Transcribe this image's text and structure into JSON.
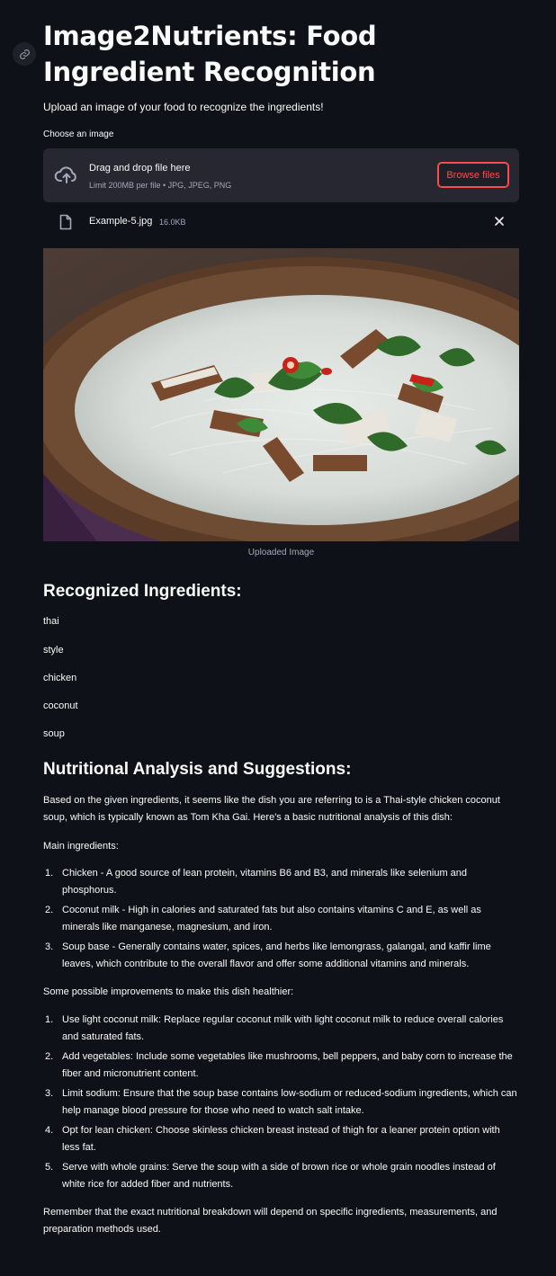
{
  "header": {
    "link_icon": "link-icon",
    "title": "Image2Nutrients: Food Ingredient Recognition",
    "subtitle": "Upload an image of your food to recognize the ingredients!"
  },
  "uploader": {
    "label": "Choose an image",
    "upload_icon": "cloud-upload-icon",
    "drop_text": "Drag and drop file here",
    "limit_text": "Limit 200MB per file • JPG, JPEG, PNG",
    "browse_label": "Browse files",
    "accent_color": "#ff4b4b",
    "file": {
      "icon": "file-icon",
      "name": "Example-5.jpg",
      "size": "16.0KB",
      "close_icon": "close-icon"
    }
  },
  "image": {
    "caption": "Uploaded Image"
  },
  "ingredients": {
    "heading": "Recognized Ingredients:",
    "items": [
      "thai",
      "style",
      "chicken",
      "coconut",
      "soup"
    ]
  },
  "analysis": {
    "heading": "Nutritional Analysis and Suggestions:",
    "intro": "Based on the given ingredients, it seems like the dish you are referring to is a Thai-style chicken coconut soup, which is typically known as Tom Kha Gai. Here's a basic nutritional analysis of this dish:",
    "main_heading": "Main ingredients:",
    "main_items": [
      "Chicken - A good source of lean protein, vitamins B6 and B3, and minerals like selenium and phosphorus.",
      "Coconut milk - High in calories and saturated fats but also contains vitamins C and E, as well as minerals like manganese, magnesium, and iron.",
      "Soup base - Generally contains water, spices, and herbs like lemongrass, galangal, and kaffir lime leaves, which contribute to the overall flavor and offer some additional vitamins and minerals."
    ],
    "improve_heading": "Some possible improvements to make this dish healthier:",
    "improve_items": [
      "Use light coconut milk: Replace regular coconut milk with light coconut milk to reduce overall calories and saturated fats.",
      "Add vegetables: Include some vegetables like mushrooms, bell peppers, and baby corn to increase the fiber and micronutrient content.",
      "Limit sodium: Ensure that the soup base contains low-sodium or reduced-sodium ingredients, which can help manage blood pressure for those who need to watch salt intake.",
      "Opt for lean chicken: Choose skinless chicken breast instead of thigh for a leaner protein option with less fat.",
      "Serve with whole grains: Serve the soup with a side of brown rice or whole grain noodles instead of white rice for added fiber and nutrients."
    ],
    "outro": "Remember that the exact nutritional breakdown will depend on specific ingredients, measurements, and preparation methods used."
  }
}
